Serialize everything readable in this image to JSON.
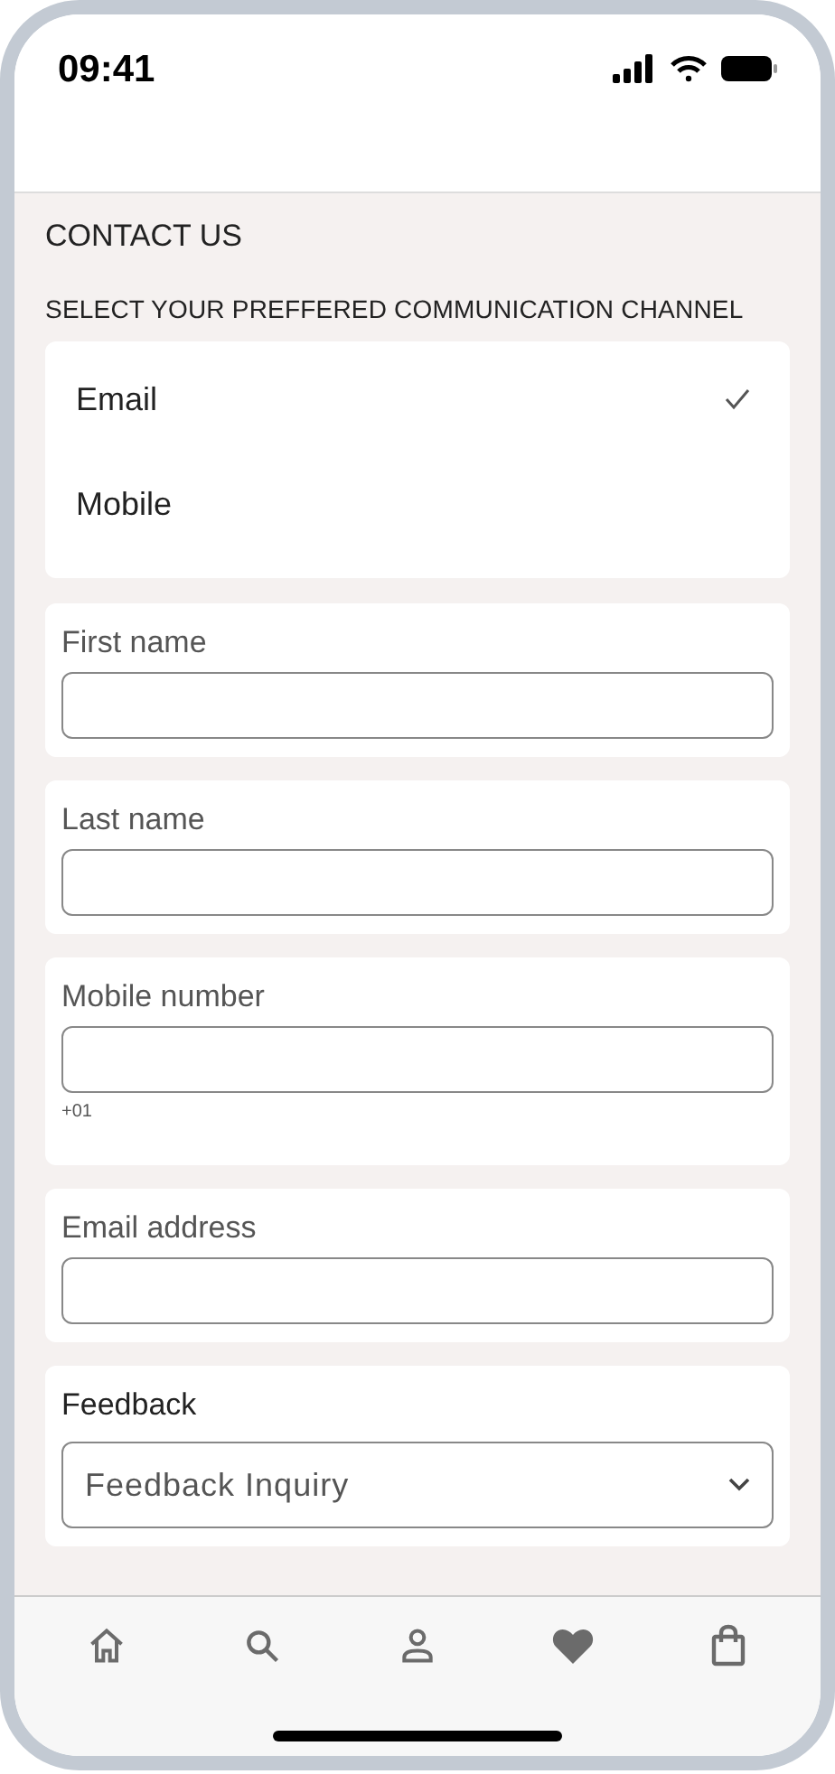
{
  "status_bar": {
    "time": "09:41"
  },
  "title": "CONTACT US",
  "channel_prompt": "SELECT YOUR PREFFERED COMMUNICATION CHANNEL",
  "channels": [
    {
      "label": "Email",
      "selected": true
    },
    {
      "label": "Mobile",
      "selected": false
    }
  ],
  "fields": [
    {
      "kind": "text",
      "label": "First name"
    },
    {
      "kind": "text",
      "label": "Last name"
    },
    {
      "kind": "text",
      "label": "Mobile number",
      "hint": "+01"
    },
    {
      "kind": "text",
      "label": "Email address"
    },
    {
      "kind": "select",
      "label": "Feedback",
      "value": "Feedback Inquiry"
    }
  ],
  "nav": [
    {
      "kind": "home"
    },
    {
      "kind": "search"
    },
    {
      "kind": "account"
    },
    {
      "kind": "favorites"
    },
    {
      "kind": "bag"
    }
  ]
}
